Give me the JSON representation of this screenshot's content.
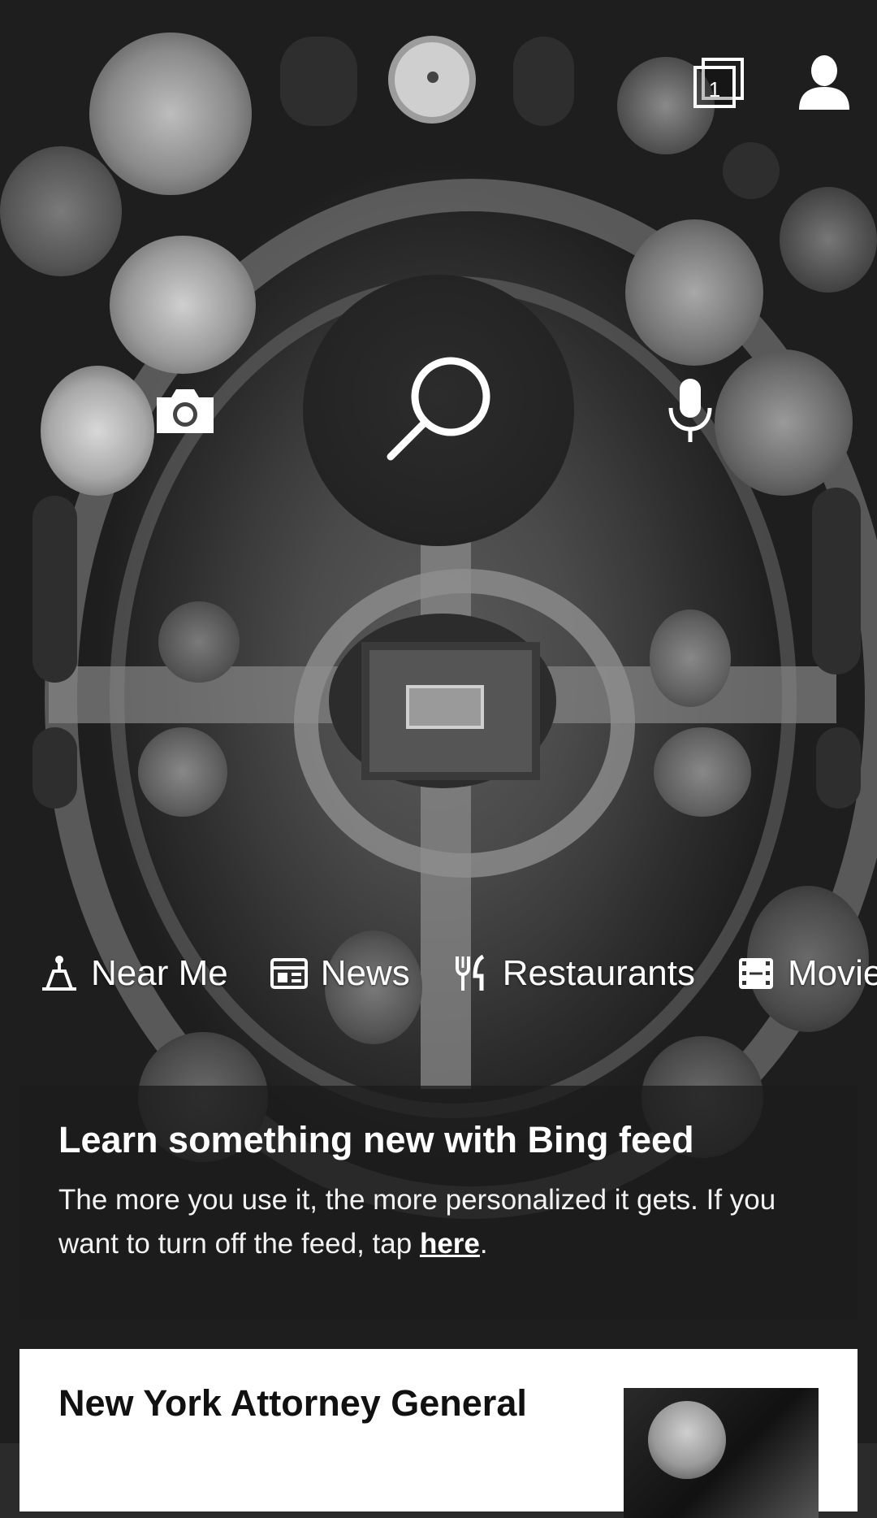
{
  "header": {
    "tab_count": "1",
    "tabs_icon": "tabs-icon",
    "profile_icon": "person-icon"
  },
  "search": {
    "search_icon": "search-icon",
    "camera_icon": "camera-icon",
    "mic_icon": "microphone-icon"
  },
  "quick_links": [
    {
      "label": "Near Me",
      "icon": "near-me-icon"
    },
    {
      "label": "News",
      "icon": "news-icon"
    },
    {
      "label": "Restaurants",
      "icon": "fork-knife-icon"
    },
    {
      "label": "Movies",
      "icon": "film-icon"
    }
  ],
  "feed_promo": {
    "title": "Learn something new with Bing feed",
    "body_before": "The more you use it, the more personalized it gets. If you want to turn off the feed, tap ",
    "link": "here",
    "body_after": "."
  },
  "news_card": {
    "headline": "New York Attorney General"
  },
  "colors": {
    "overlay": "#1c1c1c",
    "text": "#ffffff",
    "card_bg": "#ffffff"
  }
}
